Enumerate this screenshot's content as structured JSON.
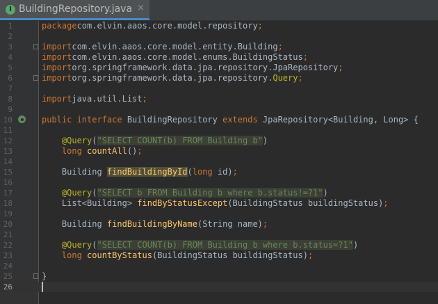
{
  "tab": {
    "icon_letter": "I",
    "title": "BuildingRepository.java",
    "close_glyph": "×"
  },
  "colors": {
    "keyword": "#cc7832",
    "annotation": "#bbb529",
    "string": "#6a8759",
    "method": "#ffc66d",
    "field": "#9876aa",
    "default_text": "#a9b7c6"
  },
  "editor": {
    "current_line": 26,
    "lines": [
      {
        "n": "1",
        "tokens": [
          [
            "kw",
            "package"
          ],
          [
            "",
            "com.elvin.aaos.core.model.repository"
          ],
          [
            "kw",
            ";"
          ]
        ]
      },
      {
        "n": "2",
        "tokens": []
      },
      {
        "n": "3",
        "fold": true,
        "tokens": [
          [
            "kw",
            "import"
          ],
          [
            "",
            "com.elvin.aaos.core.model.entity.Building"
          ],
          [
            "kw",
            ";"
          ]
        ]
      },
      {
        "n": "4",
        "tokens": [
          [
            "kw",
            "import"
          ],
          [
            "",
            "com.elvin.aaos.core.model.enums.BuildingStatus"
          ],
          [
            "kw",
            ";"
          ]
        ]
      },
      {
        "n": "5",
        "tokens": [
          [
            "kw",
            "import"
          ],
          [
            "",
            "org.springframework.data.jpa.repository.JpaRepository"
          ],
          [
            "kw",
            ";"
          ]
        ]
      },
      {
        "n": "6",
        "fold": true,
        "tokens": [
          [
            "kw",
            "import"
          ],
          [
            "",
            "org.springframework.data.jpa.repository."
          ],
          [
            "ann",
            "Query"
          ],
          [
            "kw",
            ";"
          ]
        ]
      },
      {
        "n": "7",
        "tokens": []
      },
      {
        "n": "8",
        "tokens": [
          [
            "kw",
            "import"
          ],
          [
            "",
            "java.util.List"
          ],
          [
            "kw",
            ";"
          ]
        ]
      },
      {
        "n": "9",
        "tokens": []
      },
      {
        "n": "10",
        "impl": true,
        "tokens": [
          [
            "kw",
            "public interface"
          ],
          [
            "",
            " BuildingRepository "
          ],
          [
            "kw",
            "extends"
          ],
          [
            "",
            " JpaRepository<Building, Long> {"
          ]
        ]
      },
      {
        "n": "11",
        "tokens": []
      },
      {
        "n": "12",
        "tokens": [
          [
            "",
            "    "
          ],
          [
            "ann",
            "@Query"
          ],
          [
            "",
            "("
          ],
          [
            "str hl-sql",
            "\"SELECT COUNT(b) FROM Building b\""
          ],
          [
            "",
            ")"
          ]
        ]
      },
      {
        "n": "13",
        "tokens": [
          [
            "",
            "    "
          ],
          [
            "kw",
            "long"
          ],
          [
            "",
            " "
          ],
          [
            "fn",
            "countAll"
          ],
          [
            "",
            "()"
          ],
          [
            "kw",
            ";"
          ]
        ]
      },
      {
        "n": "14",
        "tokens": []
      },
      {
        "n": "15",
        "tokens": [
          [
            "",
            "    Building "
          ],
          [
            "fn hl-usage",
            "findBuildingById"
          ],
          [
            "",
            "("
          ],
          [
            "kw",
            "long"
          ],
          [
            "",
            " id)"
          ],
          [
            "kw",
            ";"
          ]
        ]
      },
      {
        "n": "16",
        "tokens": []
      },
      {
        "n": "17",
        "tokens": [
          [
            "",
            "    "
          ],
          [
            "ann",
            "@Query"
          ],
          [
            "",
            "("
          ],
          [
            "str hl-sql",
            "\"SELECT b FROM Building b where b.status!=?1\""
          ],
          [
            "",
            ")"
          ]
        ]
      },
      {
        "n": "18",
        "tokens": [
          [
            "",
            "    List<Building> "
          ],
          [
            "fn",
            "findByStatusExcept"
          ],
          [
            "",
            "(BuildingStatus buildingStatus)"
          ],
          [
            "kw",
            ";"
          ]
        ]
      },
      {
        "n": "19",
        "tokens": []
      },
      {
        "n": "20",
        "tokens": [
          [
            "",
            "    Building "
          ],
          [
            "fn",
            "findBuildingByName"
          ],
          [
            "",
            "(String name)"
          ],
          [
            "kw",
            ";"
          ]
        ]
      },
      {
        "n": "21",
        "tokens": []
      },
      {
        "n": "22",
        "tokens": [
          [
            "",
            "    "
          ],
          [
            "ann",
            "@Query"
          ],
          [
            "",
            "("
          ],
          [
            "str hl-sql",
            "\"SELECT COUNT(b) FROM Building b where b.status=?1\""
          ],
          [
            "",
            ")"
          ]
        ]
      },
      {
        "n": "23",
        "tokens": [
          [
            "",
            "    "
          ],
          [
            "kw",
            "long"
          ],
          [
            "",
            " "
          ],
          [
            "fn",
            "countByStatus"
          ],
          [
            "",
            "(BuildingStatus buildingStatus)"
          ],
          [
            "kw",
            ";"
          ]
        ]
      },
      {
        "n": "24",
        "tokens": []
      },
      {
        "n": "25",
        "fold": true,
        "tokens": [
          [
            "",
            "}"
          ]
        ]
      },
      {
        "n": "26",
        "tokens": []
      }
    ]
  }
}
